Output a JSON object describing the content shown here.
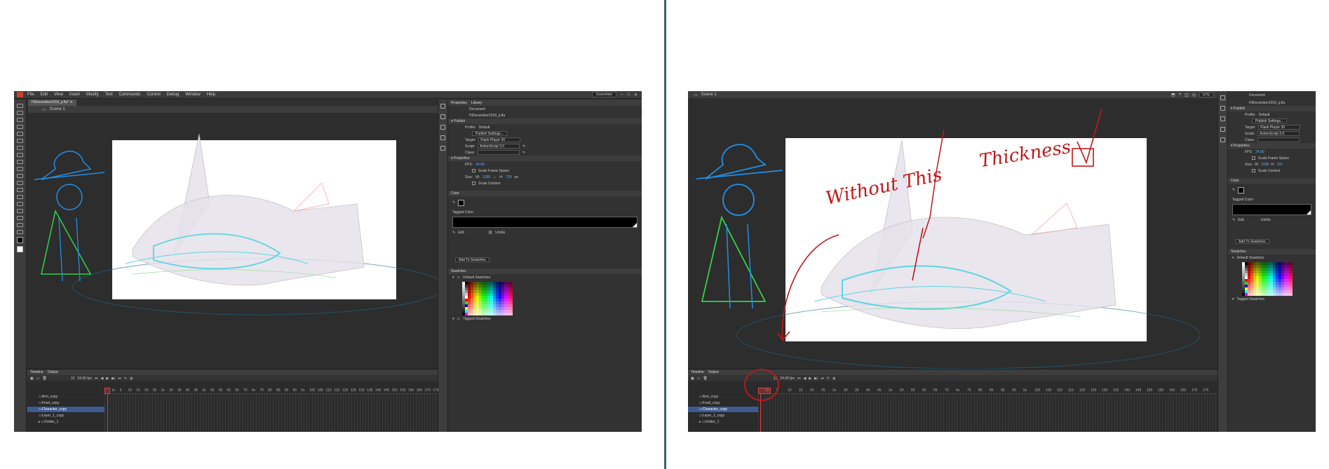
{
  "menus": [
    "File",
    "Edit",
    "View",
    "Insert",
    "Modify",
    "Text",
    "Commands",
    "Control",
    "Debug",
    "Window",
    "Help"
  ],
  "workspace": "Essentials",
  "document_tab": "HiDecember2018_p.fla*",
  "scene": "Scene 1",
  "zoom": "67%",
  "properties_panel": {
    "tabs": [
      "Properties",
      "Library"
    ],
    "doc_type": "Document",
    "doc_name": "HiDecember2018_p.fla",
    "publish_section": "Publish",
    "profile_label": "Profile:",
    "profile_value": "Default",
    "publish_settings_button": "Publish Settings...",
    "target_label": "Target:",
    "target_value": "Flash Player 30",
    "script_label": "Script:",
    "script_value": "ActionScript 3.0",
    "class_label": "Class:",
    "properties_section": "Properties",
    "fps_label": "FPS:",
    "fps_value": "24.00",
    "scale_frame_spans": "Scale Frame Spans",
    "size_label": "Size:",
    "w_label": "W:",
    "w_value": "1280",
    "h_label": "H:",
    "h_value": "720",
    "px_unit": "px",
    "scale_content": "Scale Content"
  },
  "color_panel": {
    "title": "Color",
    "tagged_color": "Tagged Color:",
    "edit": "Edit",
    "unlink": "Unlink",
    "add_button": "Add To Swatches"
  },
  "swatches_panel": {
    "title": "Swatches",
    "default_swatches": "Default Swatches",
    "tagged_swatches": "Tagged Swatches"
  },
  "timeline": {
    "tabs": [
      "Timeline",
      "Output"
    ],
    "frame_counter": "12",
    "fps_readout": "24.00 fps",
    "ruler_ticks": [
      "1s",
      "5",
      "10",
      "15",
      "20",
      "25",
      "2s",
      "30",
      "35",
      "40",
      "45",
      "3s",
      "50",
      "55",
      "60",
      "65",
      "70",
      "4s",
      "75",
      "80",
      "85",
      "90",
      "95",
      "5s",
      "100",
      "105",
      "110",
      "115",
      "120",
      "125",
      "130",
      "135",
      "140",
      "145",
      "150",
      "155",
      "160",
      "165",
      "170",
      "175"
    ],
    "layers": [
      {
        "name": "Arm_copy",
        "selected": false
      },
      {
        "name": "Food_copy",
        "selected": false
      },
      {
        "name": "Character_copy",
        "selected": true
      },
      {
        "name": "Layer_1_copy",
        "selected": false
      },
      {
        "name": "Folder_1",
        "selected": false
      }
    ]
  },
  "annotations": {
    "without_this": "Without This",
    "thickness": "Thickness",
    "check": "✓"
  },
  "colors": {
    "annotation": "#c01818",
    "sketch_blue": "#1f8fe8",
    "sketch_green": "#2fd24a",
    "sketch_cyan": "#5dd5dd",
    "playhead": "#e03a3a",
    "selected_layer": "#3d5b8f"
  }
}
